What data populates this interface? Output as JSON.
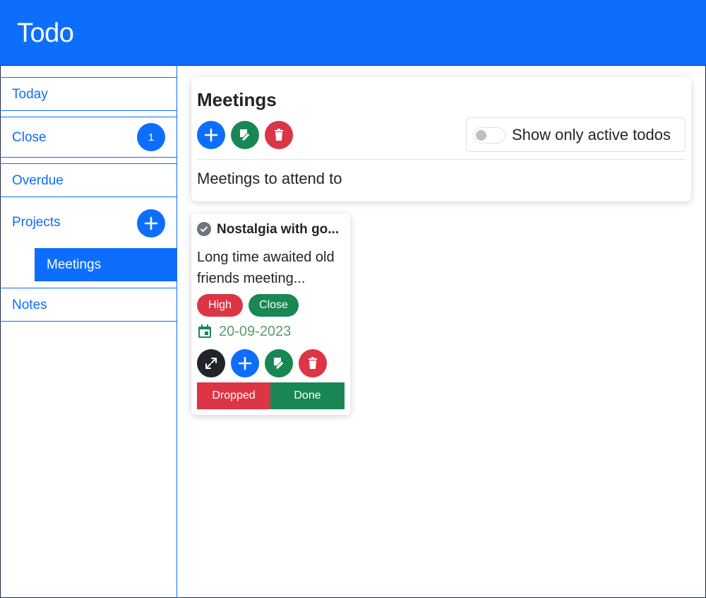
{
  "app": {
    "title": "Todo"
  },
  "sidebar": {
    "items": [
      {
        "label": "Today"
      },
      {
        "label": "Close",
        "count": "1"
      },
      {
        "label": "Overdue"
      },
      {
        "label": "Projects"
      },
      {
        "label": "Notes"
      }
    ],
    "projects": [
      {
        "label": "Meetings",
        "selected": true
      }
    ]
  },
  "project": {
    "title": "Meetings",
    "description": "Meetings to attend to",
    "toggle_label": "Show only active todos",
    "toggle_on": false
  },
  "todos": [
    {
      "title": "Nostalgia with go...",
      "description": "Long time awaited old friends meeting...",
      "priority": "High",
      "status": "Close",
      "date": "20-09-2023",
      "actions": {
        "dropped": "Dropped",
        "done": "Done"
      }
    }
  ],
  "colors": {
    "primary": "#0d6efd",
    "success": "#198754",
    "danger": "#dc3545",
    "dark": "#212529",
    "secondary": "#6c757d"
  },
  "icons": {
    "add": "plus-icon",
    "edit": "edit-icon",
    "delete": "trash-icon",
    "expand": "expand-icon",
    "check": "check-circle-icon",
    "calendar": "calendar-icon"
  }
}
